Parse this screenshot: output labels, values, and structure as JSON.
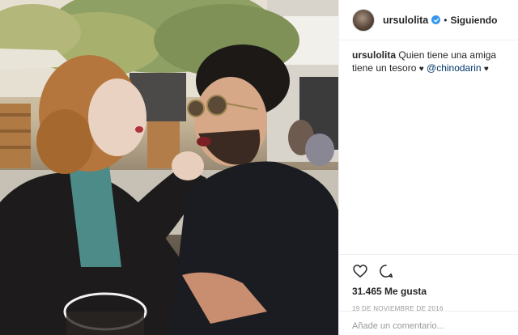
{
  "post": {
    "username": "ursulolita",
    "follow_status": "Siguiendo",
    "separator": "•"
  },
  "caption": {
    "username": "ursulolita",
    "text": "Quien tiene una amiga tiene un tesoro",
    "heart": "♥",
    "mention": "@chinodarin",
    "heart2": "♥"
  },
  "stats": {
    "likes": "31.465 Me gusta",
    "date": "19 de noviembre de 2016"
  },
  "comment": {
    "placeholder": "Añade un comentario..."
  },
  "icons": {
    "like": "heart-icon",
    "comment": "comment-icon",
    "verified": "verified-badge-icon"
  },
  "colors": {
    "accent": "#3897f0",
    "mention": "#003569",
    "muted": "#999999",
    "text": "#262626"
  }
}
